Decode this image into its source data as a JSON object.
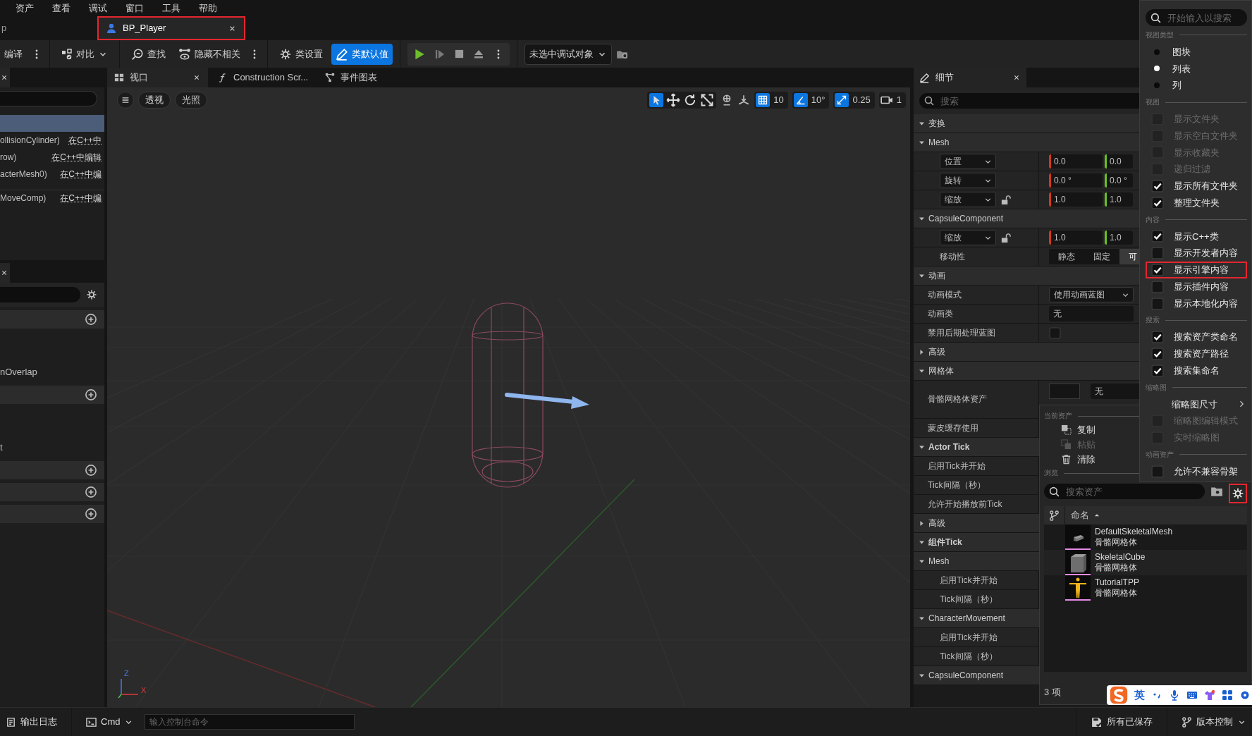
{
  "menu_bar": [
    "资产",
    "查看",
    "调试",
    "窗口",
    "工具",
    "帮助"
  ],
  "document_tabs": [
    {
      "label": "p",
      "selected": false,
      "highlighted": false
    },
    {
      "label": "BP_Player",
      "selected": true,
      "highlighted": true
    }
  ],
  "toolbar": {
    "compile": "编译",
    "diff": "对比",
    "find": "查找",
    "hide_unrelated": "隐藏不相关",
    "class_settings": "类设置",
    "class_defaults": "类默认值",
    "debug_object": "未选中调试对象"
  },
  "components_panel": {
    "rows": [
      {
        "selected": true
      },
      {
        "label": "ollisionCylinder)",
        "link": "在C++中",
        "selected": false
      },
      {
        "label": "row)",
        "link": "在C++中编辑",
        "selected": false
      },
      {
        "label": "acterMesh0)",
        "link": "在C++中编",
        "selected": false
      },
      {
        "label": "MoveComp)",
        "link": "在C++中编",
        "selected": false
      }
    ]
  },
  "my_blueprint_panel": {
    "rows": [
      {
        "kind": "header"
      },
      {
        "kind": "item",
        "label": "nOverlap"
      },
      {
        "kind": "header"
      },
      {
        "kind": "item",
        "label": "t"
      },
      {
        "kind": "header"
      },
      {
        "kind": "header"
      },
      {
        "kind": "header"
      }
    ]
  },
  "viewport": {
    "tabs": [
      {
        "label": "视口",
        "selected": true
      },
      {
        "label": "Construction Scr...",
        "selected": false
      },
      {
        "label": "事件图表",
        "selected": false
      }
    ],
    "view_mode": "透视",
    "lighting": "光照",
    "tools": [
      {
        "selected": true
      },
      {
        "selected": false
      },
      {
        "selected": false
      },
      {
        "selected": false
      }
    ],
    "snaps": [
      {
        "value": "10",
        "on": true
      },
      {
        "value": "10°",
        "on": true
      },
      {
        "value": "0.25",
        "on": true
      }
    ],
    "camera_speed": "1",
    "axis_labels": [
      "Z",
      "X"
    ]
  },
  "details": {
    "title": "细节",
    "search_placeholder": "搜索",
    "rows": [
      {
        "kind": "section",
        "label": "变换",
        "expanded": true,
        "bold": false,
        "children": [
          {
            "kind": "section",
            "label": "Mesh",
            "expanded": true,
            "bold": false,
            "children": [
              {
                "kind": "vector",
                "label": "位置",
                "values": [
                  "0.0",
                  "0.0"
                ],
                "lock_icon": false
              },
              {
                "kind": "vector",
                "label": "旋转",
                "values": [
                  "0.0 °",
                  "0.0 °"
                ],
                "lock_icon": false
              },
              {
                "kind": "vector",
                "label": "缩放",
                "values": [
                  "1.0",
                  "1.0"
                ],
                "lock_icon": true
              }
            ]
          },
          {
            "kind": "section",
            "label": "CapsuleComponent",
            "expanded": true,
            "bold": false,
            "children": [
              {
                "kind": "vector",
                "label": "缩放",
                "values": [
                  "1.0",
                  "1.0"
                ],
                "lock_icon": true
              },
              {
                "kind": "segmented",
                "label": "移动性",
                "options": [
                  {
                    "label": "静态",
                    "selected": false
                  },
                  {
                    "label": "固定",
                    "selected": false
                  },
                  {
                    "label": "可",
                    "selected": true
                  }
                ]
              }
            ]
          }
        ]
      },
      {
        "kind": "section",
        "label": "动画",
        "expanded": true,
        "bold": false,
        "children": [
          {
            "kind": "dropdown",
            "label": "动画模式",
            "value": "使用动画蓝图"
          },
          {
            "kind": "text",
            "label": "动画类",
            "value": "无"
          },
          {
            "kind": "checkbox",
            "label": "禁用后期处理蓝图",
            "checked": false
          },
          {
            "kind": "section",
            "label": "高级",
            "expanded": false,
            "bold": false
          }
        ]
      },
      {
        "kind": "section",
        "label": "网格体",
        "expanded": true,
        "bold": false,
        "children": [
          {
            "kind": "asset",
            "label": "骨骼网格体资产",
            "value": "无"
          },
          {
            "kind": "plain",
            "label": "蒙皮缓存使用"
          }
        ]
      },
      {
        "kind": "section",
        "label": "Actor Tick",
        "expanded": true,
        "bold": true,
        "children": [
          {
            "kind": "plain",
            "label": "启用Tick并开始"
          },
          {
            "kind": "plain",
            "label": "Tick间隔（秒）"
          },
          {
            "kind": "plain",
            "label": "允许开始播放前Tick"
          },
          {
            "kind": "section",
            "label": "高级",
            "expanded": false,
            "bold": false
          }
        ]
      },
      {
        "kind": "section",
        "label": "组件Tick",
        "expanded": true,
        "bold": true,
        "children": [
          {
            "kind": "section",
            "label": "Mesh",
            "expanded": true,
            "bold": false,
            "children": [
              {
                "kind": "plain",
                "label": "启用Tick并开始"
              },
              {
                "kind": "plain",
                "label": "Tick间隔（秒）"
              }
            ]
          },
          {
            "kind": "section",
            "label": "CharacterMovement",
            "expanded": true,
            "bold": false,
            "children": [
              {
                "kind": "plain",
                "label": "启用Tick并开始"
              },
              {
                "kind": "plain",
                "label": "Tick间隔（秒）"
              }
            ]
          },
          {
            "kind": "section",
            "label": "CapsuleComponent",
            "expanded": true,
            "bold": false
          }
        ]
      }
    ]
  },
  "asset_picker": {
    "current_heading": "当前资产",
    "actions": [
      {
        "label": "复制",
        "disabled": false
      },
      {
        "label": "粘贴",
        "disabled": true
      },
      {
        "label": "清除",
        "disabled": false
      }
    ],
    "browse_heading": "浏览",
    "search_placeholder": "搜索资产",
    "settings_highlighted": true,
    "column": "命名",
    "assets": [
      {
        "name": "DefaultSkeletalMesh",
        "type": "骨骼网格体"
      },
      {
        "name": "SkeletalCube",
        "type": "骨骼网格体"
      },
      {
        "name": "TutorialTPP",
        "type": "骨骼网格体"
      }
    ],
    "count": "3 项"
  },
  "view_options_menu": {
    "search_placeholder": "开始输入以搜索",
    "items": [
      {
        "kind": "heading",
        "label": "视图类型"
      },
      {
        "kind": "radio",
        "label": "图块",
        "selected": false
      },
      {
        "kind": "radio",
        "label": "列表",
        "selected": true
      },
      {
        "kind": "radio",
        "label": "列",
        "selected": false
      },
      {
        "kind": "heading",
        "label": "视图"
      },
      {
        "kind": "check",
        "label": "显示文件夹",
        "checked": false,
        "disabled": true,
        "highlighted": false
      },
      {
        "kind": "check",
        "label": "显示空白文件夹",
        "checked": false,
        "disabled": true,
        "highlighted": false
      },
      {
        "kind": "check",
        "label": "显示收藏夹",
        "checked": false,
        "disabled": true,
        "highlighted": false
      },
      {
        "kind": "check",
        "label": "递归过滤",
        "checked": false,
        "disabled": true,
        "highlighted": false
      },
      {
        "kind": "check",
        "label": "显示所有文件夹",
        "checked": true,
        "disabled": false,
        "highlighted": false
      },
      {
        "kind": "check",
        "label": "整理文件夹",
        "checked": true,
        "disabled": false,
        "highlighted": false
      },
      {
        "kind": "heading",
        "label": "内容"
      },
      {
        "kind": "check",
        "label": "显示C++类",
        "checked": true,
        "disabled": false,
        "highlighted": false
      },
      {
        "kind": "check",
        "label": "显示开发者内容",
        "checked": false,
        "disabled": false,
        "highlighted": false
      },
      {
        "kind": "check",
        "label": "显示引擎内容",
        "checked": true,
        "disabled": false,
        "highlighted": true
      },
      {
        "kind": "check",
        "label": "显示插件内容",
        "checked": false,
        "disabled": false,
        "highlighted": false
      },
      {
        "kind": "check",
        "label": "显示本地化内容",
        "checked": false,
        "disabled": false,
        "highlighted": false
      },
      {
        "kind": "heading",
        "label": "搜索"
      },
      {
        "kind": "check",
        "label": "搜索资产类命名",
        "checked": true,
        "disabled": false,
        "highlighted": false
      },
      {
        "kind": "check",
        "label": "搜索资产路径",
        "checked": true,
        "disabled": false,
        "highlighted": false
      },
      {
        "kind": "check",
        "label": "搜索集命名",
        "checked": true,
        "disabled": false,
        "highlighted": false
      },
      {
        "kind": "heading",
        "label": "缩略图"
      },
      {
        "kind": "submenu",
        "label": "缩略图尺寸"
      },
      {
        "kind": "check",
        "label": "缩略图编辑模式",
        "checked": false,
        "disabled": true,
        "highlighted": false
      },
      {
        "kind": "check",
        "label": "实时缩略图",
        "checked": false,
        "disabled": true,
        "highlighted": false
      },
      {
        "kind": "heading",
        "label": "动画资产"
      },
      {
        "kind": "check",
        "label": "允许不兼容骨架",
        "checked": false,
        "disabled": false,
        "highlighted": false
      }
    ]
  },
  "bottom_bar": {
    "output_log": "输出日志",
    "cmd": "Cmd",
    "console_placeholder": "输入控制台命令",
    "save_status": "所有已保存",
    "source_control": "版本控制"
  },
  "ime_bar": {
    "language": "英"
  }
}
